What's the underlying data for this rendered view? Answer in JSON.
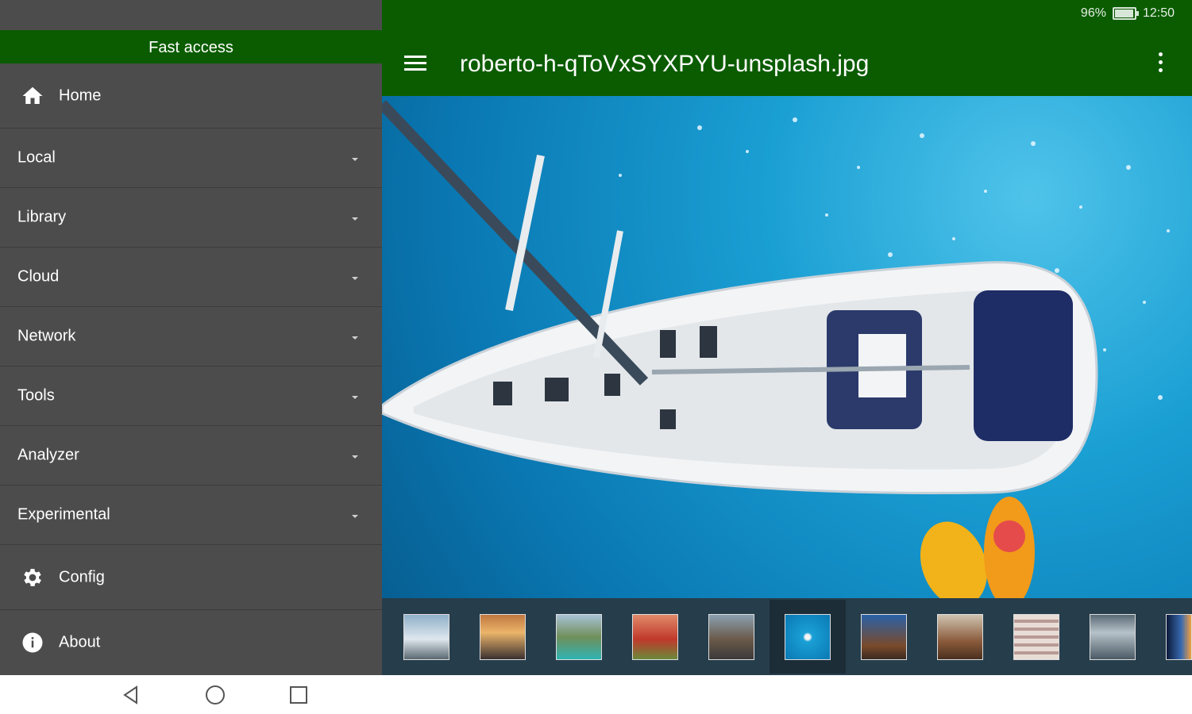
{
  "status": {
    "battery": "96%",
    "time": "12:50"
  },
  "drawer": {
    "title": "Fast access",
    "items": [
      {
        "label": "Home",
        "icon": "home-icon",
        "expandable": false
      },
      {
        "label": "Local",
        "expandable": true
      },
      {
        "label": "Library",
        "expandable": true
      },
      {
        "label": "Cloud",
        "expandable": true
      },
      {
        "label": "Network",
        "expandable": true
      },
      {
        "label": "Tools",
        "expandable": true
      },
      {
        "label": "Analyzer",
        "expandable": true
      },
      {
        "label": "Experimental",
        "expandable": true
      },
      {
        "label": "Config",
        "icon": "gear-icon",
        "expandable": false
      },
      {
        "label": "About",
        "icon": "info-icon",
        "expandable": false
      }
    ]
  },
  "toolbar": {
    "title": "roberto-h-qToVxSYXPYU-unsplash.jpg"
  },
  "colors": {
    "brand": "#0b5c00",
    "drawer_bg": "#4c4c4c"
  },
  "viewer": {
    "image_subject": "sailboat-on-blue-sea",
    "selected_thumbnail_index": 5
  },
  "thumbnails": [
    "mountain",
    "sunset-tower",
    "coast-bay",
    "red-lake",
    "rock-cliff",
    "sailboat",
    "lighthouse",
    "cliff-person",
    "building",
    "gray-sea",
    "night-sky"
  ]
}
